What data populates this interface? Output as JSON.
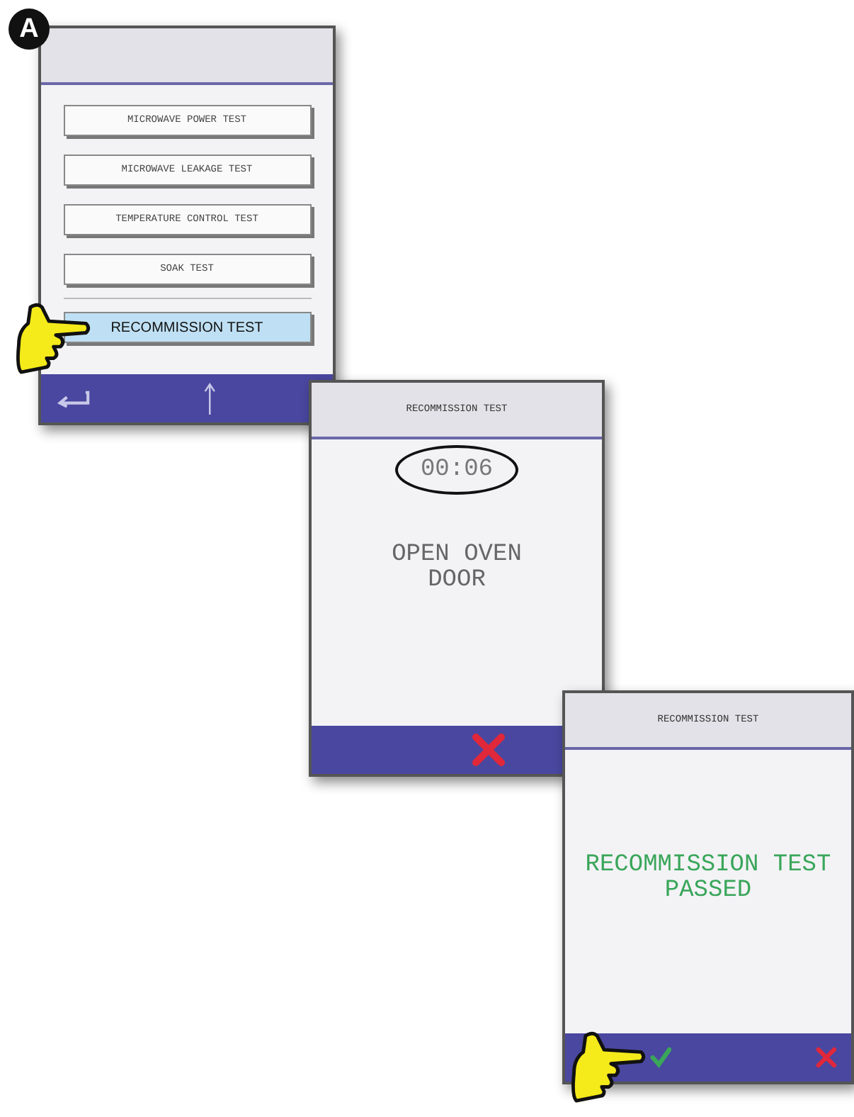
{
  "badge": "A",
  "screens": [
    {
      "kind": "menu",
      "items": [
        {
          "label": "MICROWAVE POWER TEST",
          "selected": false
        },
        {
          "label": "MICROWAVE LEAKAGE TEST",
          "selected": false
        },
        {
          "label": "TEMPERATURE CONTROL TEST",
          "selected": false
        },
        {
          "label": "SOAK TEST",
          "selected": false
        },
        {
          "label": "RECOMMISSION TEST",
          "selected": true
        }
      ]
    },
    {
      "kind": "timer",
      "title": "RECOMMISSION TEST",
      "timer": "00:06",
      "message": "OPEN OVEN DOOR"
    },
    {
      "kind": "result",
      "title": "RECOMMISSION TEST",
      "message": "RECOMMISSION TEST PASSED"
    }
  ]
}
